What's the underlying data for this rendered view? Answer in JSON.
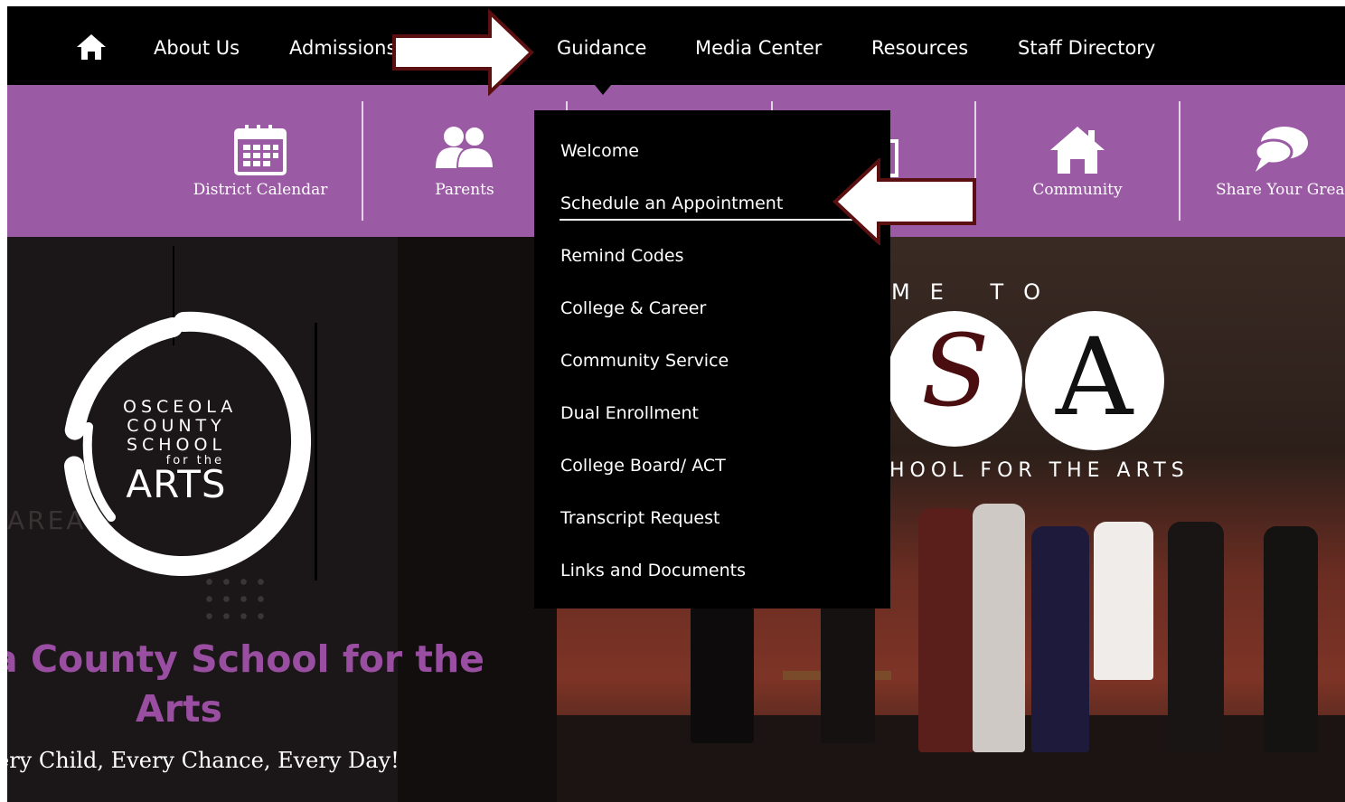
{
  "nav": {
    "items": [
      "About Us",
      "Admissions",
      "Guidance",
      "Media Center",
      "Resources",
      "Staff Directory"
    ]
  },
  "quicklinks": [
    {
      "label": "District Calendar",
      "icon": "calendar-icon"
    },
    {
      "label": "Parents",
      "icon": "parents-icon"
    },
    {
      "label": "Community",
      "icon": "house-icon"
    },
    {
      "label": "Share Your Great",
      "icon": "speech-bubble-icon"
    }
  ],
  "dropdown": {
    "items": [
      "Welcome",
      "Schedule an Appointment",
      "Remind Codes",
      "College & Career",
      "Community Service",
      "Dual Enrollment",
      "College Board/ ACT",
      "Transcript Request",
      "Links and Documents"
    ]
  },
  "hero": {
    "welcome_partial": "ME TO",
    "school_partial": "HOOL FOR THE ARTS",
    "logo_lines": [
      "OSCEOLA",
      "COUNTY",
      "SCHOOL",
      "for the",
      "ARTS"
    ],
    "bg_partial": "AREA",
    "title_line1": "a County School for the",
    "title_line2": "Arts",
    "tagline": "ery Child, Every Chance, Every Day!"
  },
  "colors": {
    "accent_purple": "#9b5aa4",
    "title_purple": "#9a4ea2",
    "arrow_border": "#5a0f10"
  }
}
